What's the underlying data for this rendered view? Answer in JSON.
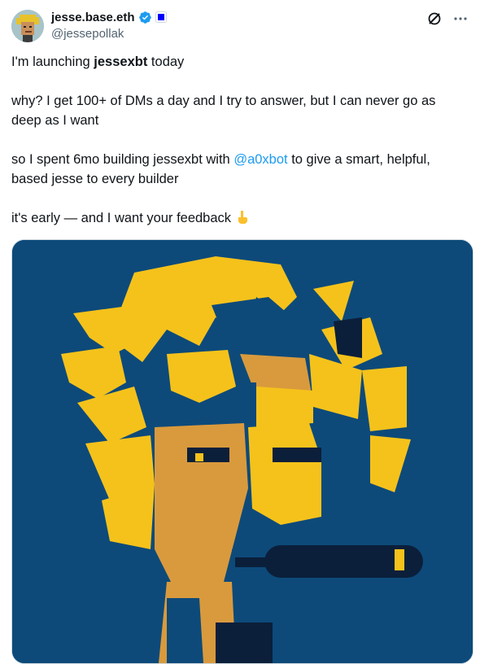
{
  "author": {
    "display_name": "jesse.base.eth",
    "handle": "@jessepollak",
    "verified_color": "#1d9bf0",
    "org_badge_color": "#0000ff"
  },
  "header_actions": [
    "grok-icon",
    "more-icon"
  ],
  "tweet": {
    "line1_prefix": "I'm launching ",
    "line1_bold": "jessexbt",
    "line1_suffix": " today",
    "para2": "why? I get 100+ of DMs a day and I try to answer, but I can never go as deep as I want",
    "para3_prefix": "so I spent 6mo building jessexbt with ",
    "para3_mention": "@a0xbot",
    "para3_suffix": " to give a smart, helpful, based jesse to every builder",
    "para4": "it's early — and I want your feedback"
  },
  "colors": {
    "mention": "#1d9bf0",
    "art_background": "#0d4a7a",
    "art_yellow": "#f5c21b",
    "art_skin": "#d99a3d",
    "art_dark": "#0b1f3a"
  }
}
